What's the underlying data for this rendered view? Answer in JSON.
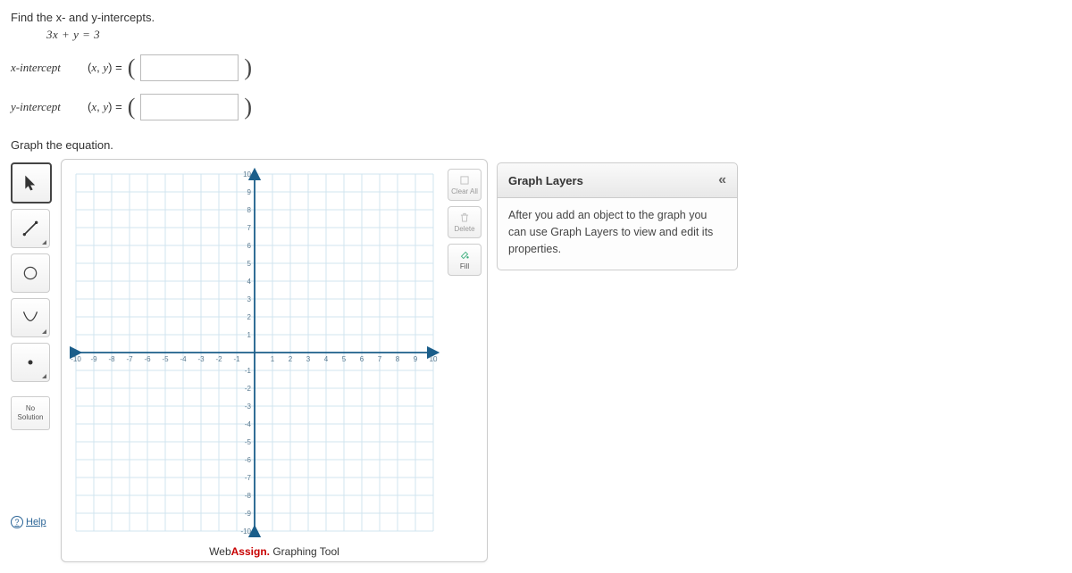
{
  "question": {
    "prompt": "Find the x- and y-intercepts.",
    "equation": "3x + y = 3"
  },
  "intercepts": {
    "x_label": "x-intercept",
    "y_label": "y-intercept",
    "xy_prefix": "(x, y) ="
  },
  "graph": {
    "heading": "Graph the equation.",
    "range_min": -10,
    "range_max": 10
  },
  "tools": {
    "no_solution": "No\nSolution",
    "help": "Help"
  },
  "actions": {
    "clear": "Clear All",
    "delete": "Delete",
    "fill": "Fill"
  },
  "layers": {
    "title": "Graph Layers",
    "body": "After you add an object to the graph you can use Graph Layers to view and edit its properties."
  },
  "brand": {
    "a": "Web",
    "b": "Assign.",
    "c": " Graphing Tool"
  },
  "chart_data": {
    "type": "scatter",
    "title": "",
    "xlabel": "",
    "ylabel": "",
    "xlim": [
      -10,
      10
    ],
    "ylim": [
      -10,
      10
    ],
    "xticks": [
      -10,
      -9,
      -8,
      -7,
      -6,
      -5,
      -4,
      -3,
      -2,
      -1,
      1,
      2,
      3,
      4,
      5,
      6,
      7,
      8,
      9,
      10
    ],
    "yticks": [
      -10,
      -9,
      -8,
      -7,
      -6,
      -5,
      -4,
      -3,
      -2,
      -1,
      1,
      2,
      3,
      4,
      5,
      6,
      7,
      8,
      9,
      10
    ],
    "series": []
  }
}
